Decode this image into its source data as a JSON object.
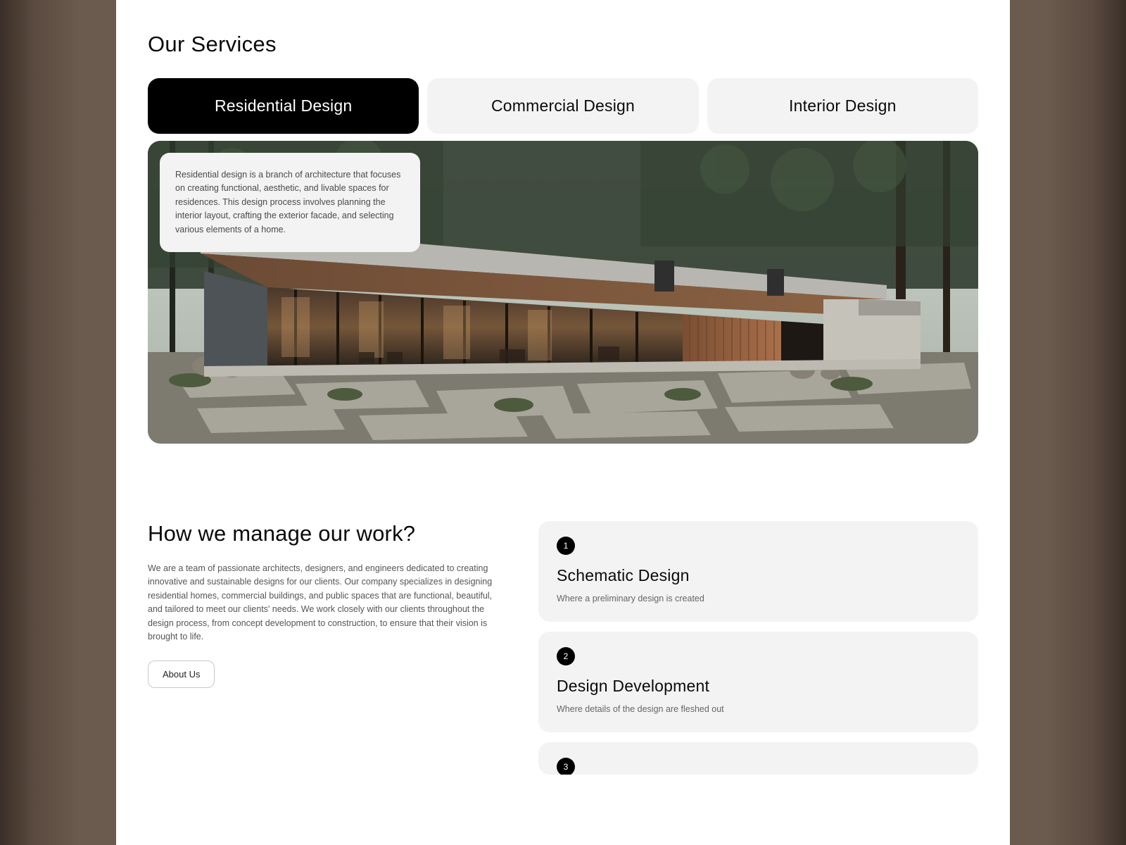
{
  "services": {
    "title": "Our Services",
    "tabs": [
      {
        "label": "Residential Design",
        "active": true
      },
      {
        "label": "Commercial Design",
        "active": false
      },
      {
        "label": "Interior Design",
        "active": false
      }
    ],
    "hero_card": "Residential design is a branch of architecture that focuses on creating functional, aesthetic, and livable spaces for residences. This design process involves planning the interior layout, crafting the exterior facade, and selecting various elements of a home."
  },
  "manage": {
    "title": "How we manage our work?",
    "body": "We are a team of passionate architects, designers, and engineers dedicated to creating innovative and sustainable designs for our clients. Our company specializes in designing residential homes, commercial buildings, and public spaces that are functional, beautiful, and tailored to meet our clients' needs. We work closely with our clients throughout the design process, from concept development to construction, to ensure that their vision is brought to life.",
    "button": "About Us",
    "steps": [
      {
        "num": "1",
        "title": "Schematic Design",
        "desc": "Where a preliminary design is created"
      },
      {
        "num": "2",
        "title": "Design Development",
        "desc": "Where details of the design are fleshed out"
      },
      {
        "num": "3",
        "title": "",
        "desc": ""
      }
    ]
  }
}
